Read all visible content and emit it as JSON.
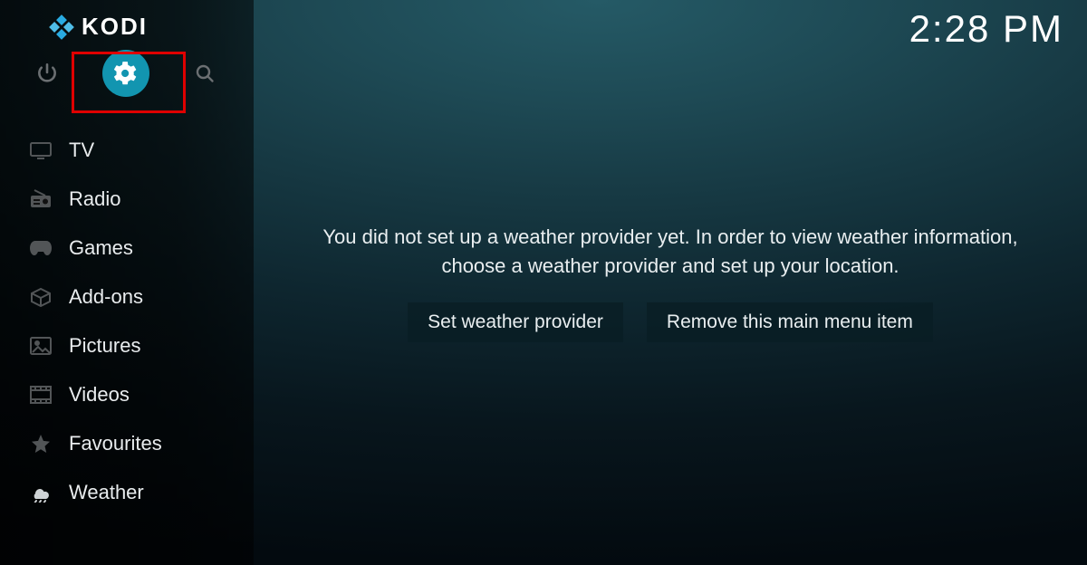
{
  "app": {
    "brand": "KODI"
  },
  "clock": "2:28 PM",
  "sidebar": {
    "items": [
      {
        "label": "TV"
      },
      {
        "label": "Radio"
      },
      {
        "label": "Games"
      },
      {
        "label": "Add-ons"
      },
      {
        "label": "Pictures"
      },
      {
        "label": "Videos"
      },
      {
        "label": "Favourites"
      },
      {
        "label": "Weather"
      }
    ]
  },
  "main": {
    "message": "You did not set up a weather provider yet. In order to view weather information, choose a weather provider and set up your location.",
    "buttons": {
      "set_provider": "Set weather provider",
      "remove_item": "Remove this main menu item"
    }
  }
}
